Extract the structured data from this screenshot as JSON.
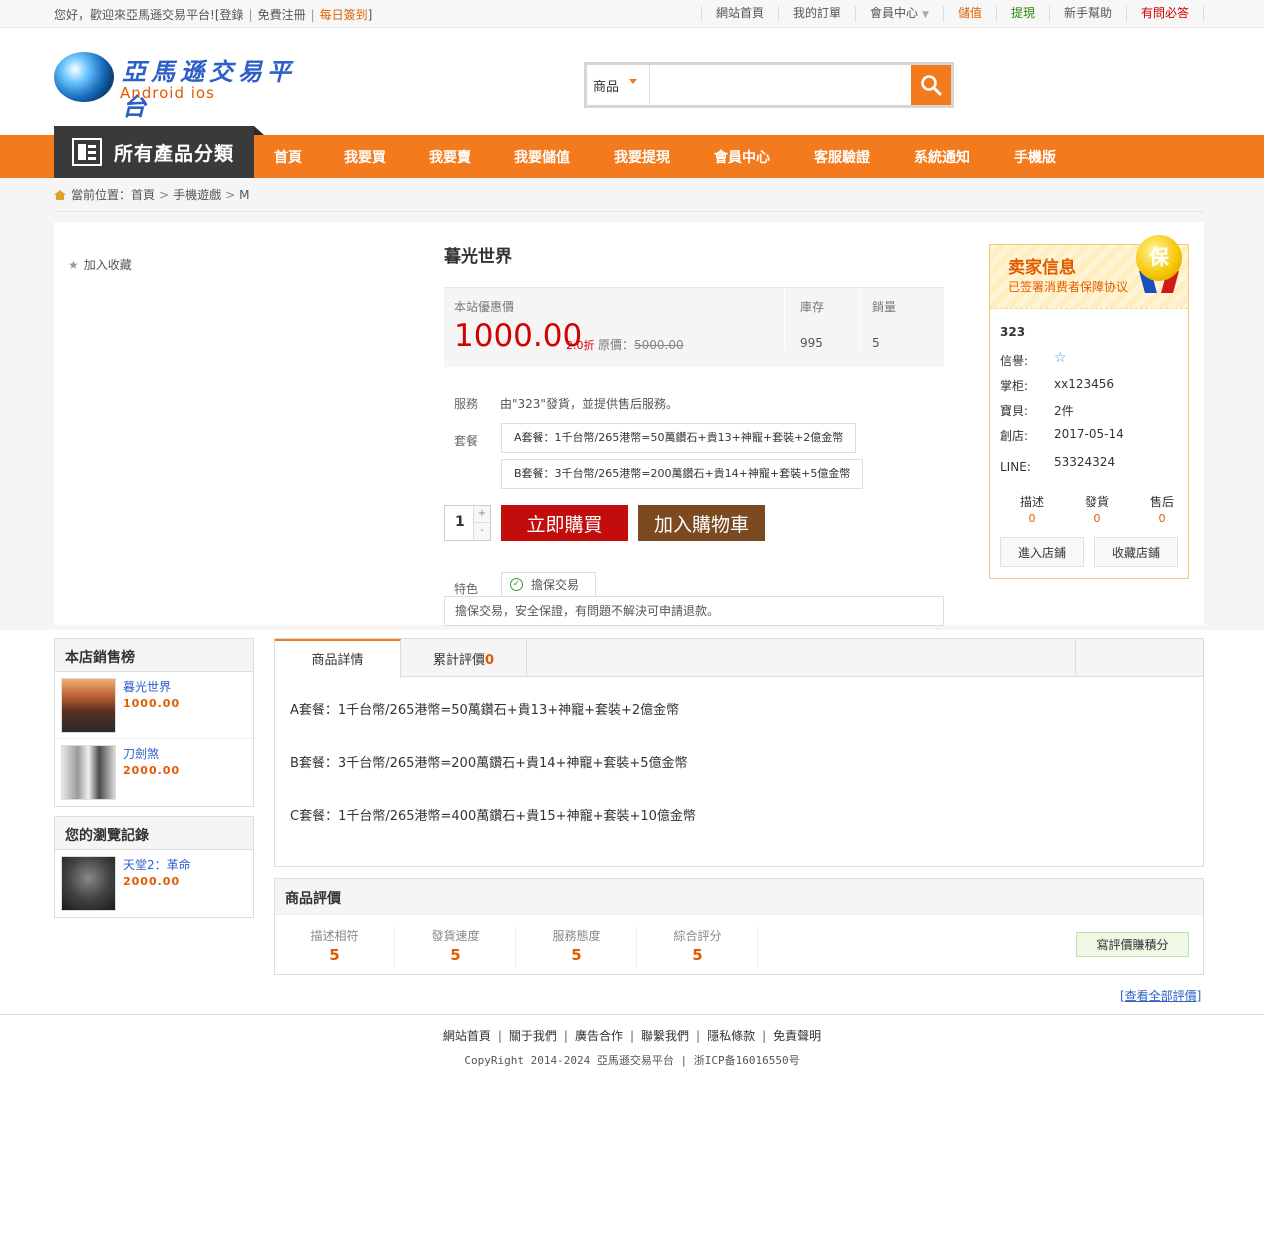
{
  "topbar": {
    "welcome": "您好，歡迎來亞馬遜交易平台!",
    "open_bracket": "[",
    "login": "登錄",
    "register": "免費注冊",
    "checkin": "每日簽到",
    "close_bracket": "]",
    "nav": [
      {
        "label": "網站首頁",
        "tone": "normal"
      },
      {
        "label": "我的訂單",
        "tone": "normal"
      },
      {
        "label": "會員中心",
        "tone": "normal",
        "caret": "▼"
      },
      {
        "label": "儲值",
        "tone": "orange"
      },
      {
        "label": "提現",
        "tone": "green"
      },
      {
        "label": "新手幫助",
        "tone": "normal"
      },
      {
        "label": "有問必答",
        "tone": "red"
      }
    ]
  },
  "header": {
    "logo_title": "亞馬遜交易平台",
    "logo_sub": "Android  ios",
    "search_category": "商品",
    "search_value": "",
    "search_placeholder": ""
  },
  "nav": {
    "all_categories": "所有產品分類",
    "items": [
      "首頁",
      "我要買",
      "我要賣",
      "我要儲值",
      "我要提現",
      "會員中心",
      "客服驗證",
      "系統通知",
      "手機版"
    ]
  },
  "breadcrumb": {
    "prefix": "當前位置：",
    "items": [
      "首頁",
      "手機遊戲",
      "M"
    ]
  },
  "product": {
    "favorite": "加入收藏",
    "title": "暮光世界",
    "price_label": "本站優惠價",
    "price": "1000.00",
    "discount": "2.0折",
    "original_label": "原價：",
    "original_price": "5000.00",
    "stock_label": "庫存",
    "stock": "995",
    "sales_label": "銷量",
    "sales": "5",
    "service_label": "服務",
    "service_text": "由\"323\"發貨，並提供售后服務。",
    "package_label": "套餐",
    "packages": [
      "A套餐：1千台幣/265港幣=50萬鑽石+貴13+神寵+套裝+2億金幣",
      "B套餐：3千台幣/265港幣=200萬鑽石+貴14+神寵+套裝+5億金幣"
    ],
    "quantity": "1",
    "qty_up": "+",
    "qty_down": "-",
    "buy_now": "立即購買",
    "add_cart": "加入購物車",
    "feature_label": "特色",
    "feature_tag": "擔保交易",
    "feature_text": "擔保交易，安全保證，有問題不解決可申請退款。"
  },
  "seller": {
    "title": "卖家信息",
    "subtitle": "已签署消费者保障协议",
    "medal": "保",
    "name": "323",
    "rows": [
      {
        "label": "信譽:",
        "value": ""
      },
      {
        "label": "掌柜:",
        "value": "xx123456"
      },
      {
        "label": "寶貝:",
        "value": "2件"
      },
      {
        "label": "創店:",
        "value": "2017-05-14"
      },
      {
        "label": "LINE:",
        "value": "53324324"
      }
    ],
    "reputation_icon": "star-icon",
    "scores": [
      {
        "label": "描述",
        "value": "0"
      },
      {
        "label": "發貨",
        "value": "0"
      },
      {
        "label": "售后",
        "value": "0"
      }
    ],
    "enter_shop": "進入店鋪",
    "fav_shop": "收藏店鋪"
  },
  "sidebar": {
    "bestsellers_title": "本店銷售榜",
    "bestsellers": [
      {
        "name": "暮光世界",
        "price": "1000.00"
      },
      {
        "name": "刀劍煞",
        "price": "2000.00"
      }
    ],
    "history_title": "您的瀏覽記錄",
    "history": [
      {
        "name": "天堂2：革命",
        "price": "2000.00"
      }
    ]
  },
  "tabs": {
    "detail": "商品詳情",
    "reviews": "累計評價",
    "review_count": "0"
  },
  "details": [
    "A套餐：1千台幣/265港幣=50萬鑽石+貴13+神寵+套裝+2億金幣",
    "B套餐：3千台幣/265港幣=200萬鑽石+貴14+神寵+套裝+5億金幣",
    "C套餐：1千台幣/265港幣=400萬鑽石+貴15+神寵+套裝+10億金幣"
  ],
  "reviews": {
    "title": "商品評價",
    "scores": [
      {
        "label": "描述相符",
        "value": "5"
      },
      {
        "label": "發貨速度",
        "value": "5"
      },
      {
        "label": "服務態度",
        "value": "5"
      },
      {
        "label": "綜合評分",
        "value": "5"
      }
    ],
    "write": "寫評價賺積分",
    "view_all": "[查看全部評價]"
  },
  "footer": {
    "links": [
      "網站首頁",
      "關于我們",
      "廣告合作",
      "聯繫我們",
      "隱私條款",
      "免責聲明"
    ],
    "copyright": "CopyRight 2014-2024 亞馬遜交易平台 | 浙ICP备16016550号"
  },
  "colors": {
    "accent": "#f37b1d",
    "price": "#d40000",
    "buy": "#c30d0d",
    "cart": "#7b4a20"
  }
}
